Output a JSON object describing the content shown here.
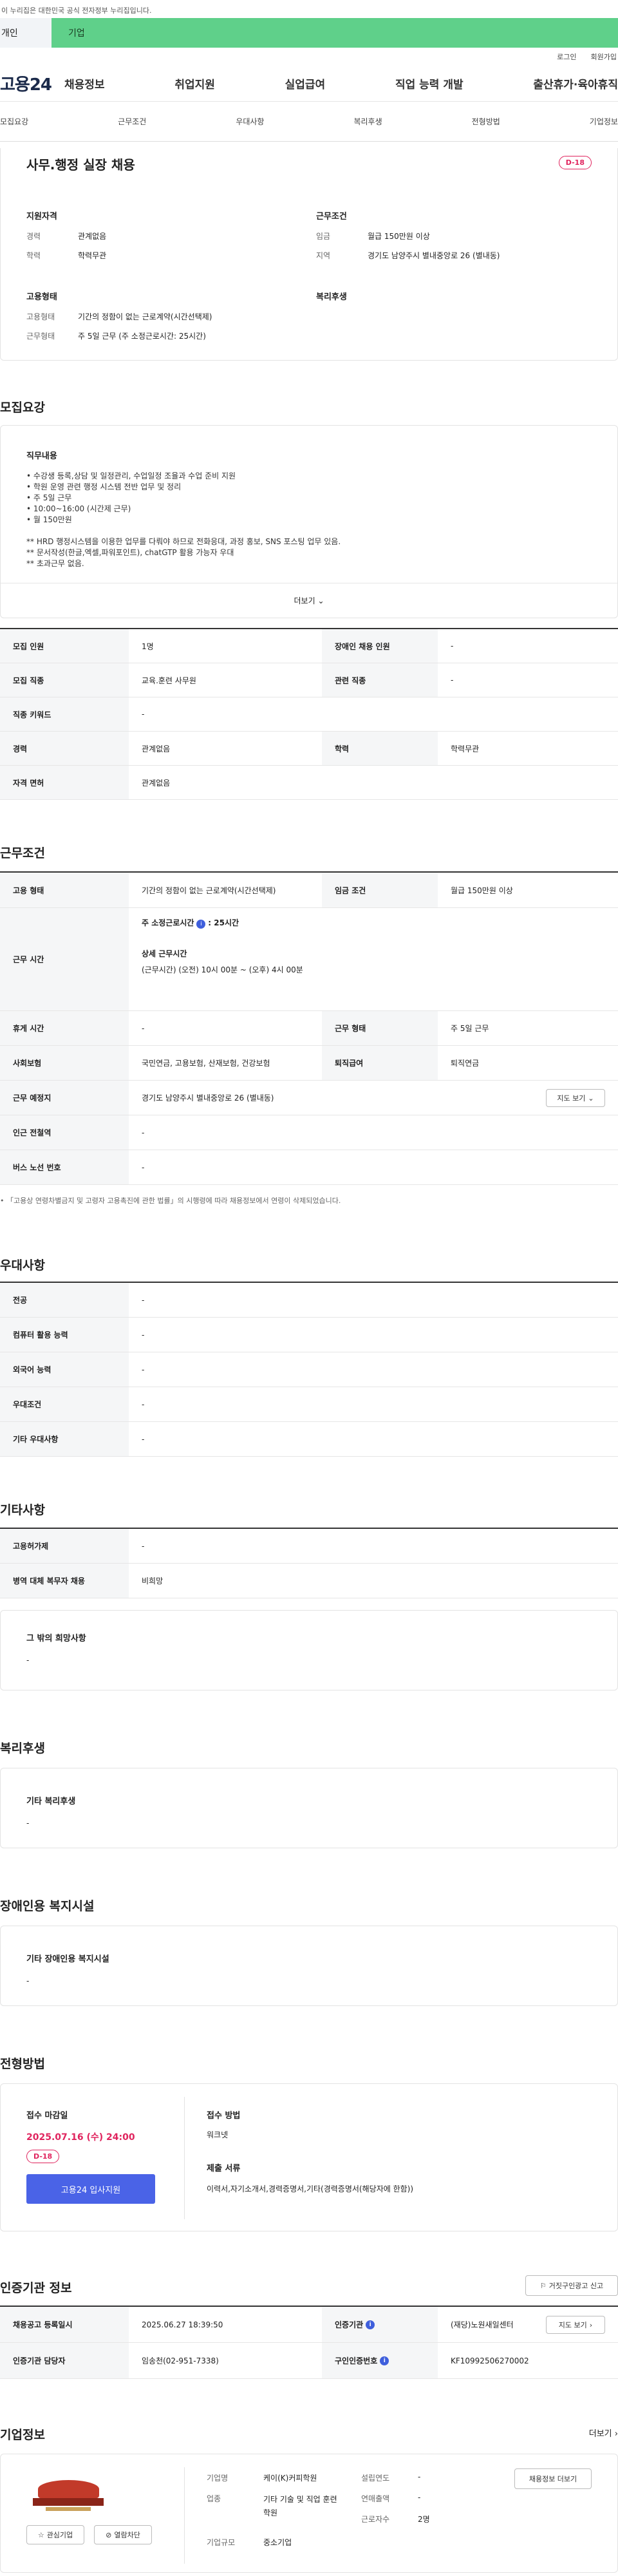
{
  "gov_banner": "이 누리집은 대한민국 공식 전자정부 누리집입니다.",
  "tabs": [
    "개인",
    "기업"
  ],
  "util": [
    "로그인",
    "회원가입"
  ],
  "logo": "고용24",
  "gnb": [
    "채용정보",
    "취업지원",
    "실업급여",
    "직업 능력 개발",
    "출산휴가·육아휴직"
  ],
  "snb": [
    "모집요강",
    "근무조건",
    "우대사항",
    "복리후생",
    "전형방법",
    "기업정보"
  ],
  "title": "사무.행정 실장 채용",
  "dday": "D-18",
  "summary": {
    "qual_title": "지원자격",
    "qual": [
      [
        "경력",
        "관계없음"
      ],
      [
        "학력",
        "학력무관"
      ]
    ],
    "cond_title": "근무조건",
    "cond": [
      [
        "임금",
        "월급 150만원 이상"
      ],
      [
        "지역",
        "경기도 남양주시 별내중앙로 26 (별내동)"
      ]
    ],
    "emp_title": "고용형태",
    "emp": [
      [
        "고용형태",
        "기간의 정함이 없는 근로계약(시간선택제)"
      ],
      [
        "근무형태",
        "주 5일 근무 (주 소정근로시간: 25시간)"
      ]
    ],
    "welfare_title": "복리후생"
  },
  "recruit": {
    "title": "모집요강",
    "job_title": "직무내용",
    "lines": [
      "• 수강생 등록,상담 및 일정관리, 수업일정 조율과 수업 준비 지원",
      "• 학원 운영 관련 행정 시스템 전반 업무 및 정리",
      "• 주 5일 근무",
      "• 10:00~16:00 (시간제 근무)",
      "• 월 150만원",
      "",
      "** HRD 행정시스템을 이용한 업무를 다뤄야 하므로 전화응대, 과정 홍보, SNS 포스팅 업무 있음.",
      "** 문서작성(한글,엑셀,파워포인트), chatGTP 활용 가능자 우대",
      "** 초과근무 없음."
    ],
    "more": "더보기",
    "rows": [
      [
        "모집 인원",
        "1명",
        "장애인 채용 인원",
        "-"
      ],
      [
        "모집 직종",
        "교육.훈련 사무원",
        "관련 직종",
        "-"
      ],
      [
        "직종 키워드",
        "-"
      ],
      [
        "경력",
        "관계없음",
        "학력",
        "학력무관"
      ],
      [
        "자격 면허",
        "관계없음"
      ]
    ]
  },
  "work": {
    "title": "근무조건",
    "emp_h": "고용 형태",
    "emp_v": "기간의 정함이 없는 근로계약(시간선택제)",
    "wage_h": "임금 조건",
    "wage_v": "월급 150만원 이상",
    "time_h": "근무 시간",
    "weekly": "주 소정근로시간",
    "weekly_v": ": 25시간",
    "detail_h": "상세 근무시간",
    "detail_v": "(근무시간) (오전) 10시 00분 ~ (오후) 4시 00분",
    "rest_h": "휴게 시간",
    "rest_v": "-",
    "form_h": "근무 형태",
    "form_v": "주 5일 근무",
    "ins_h": "사회보험",
    "ins_v": "국민연금, 고용보험, 산재보험, 건강보험",
    "ret_h": "퇴직급여",
    "ret_v": "퇴직연금",
    "place_h": "근무 예정지",
    "place_v": "경기도 남양주시 별내중앙로 26 (별내동)",
    "map_btn": "지도 보기",
    "sub_h": "인근 전철역",
    "sub_v": "-",
    "bus_h": "버스 노선 번호",
    "bus_v": "-",
    "note": "• 「고용상 연령차별금지 및 고령자 고용촉진에 관한 법률」의 시행령에 따라 채용정보에서 연령이 삭제되었습니다."
  },
  "pref": {
    "title": "우대사항",
    "rows": [
      [
        "전공",
        "-"
      ],
      [
        "컴퓨터 활용 능력",
        "-"
      ],
      [
        "외국어 능력",
        "-"
      ],
      [
        "우대조건",
        "-"
      ],
      [
        "기타 우대사항",
        "-"
      ]
    ]
  },
  "etc": {
    "title": "기타사항",
    "rows": [
      [
        "고용허가제",
        "-"
      ],
      [
        "병역 대체 복무자 채용",
        "비희망"
      ]
    ],
    "box_title": "그 밖의 희망사항",
    "box_v": "-"
  },
  "welfare": {
    "title": "복리후생",
    "box_title": "기타 복리후생",
    "box_v": "-"
  },
  "disab": {
    "title": "장애인용 복지시설",
    "box_title": "기타 장애인용 복지시설",
    "box_v": "-"
  },
  "apply": {
    "title": "전형방법",
    "deadline_h": "접수 마감일",
    "deadline": "2025.07.16 (수) 24:00",
    "dday": "D-18",
    "btn": "고용24 입사지원",
    "method_h": "접수 방법",
    "method_v": "워크넷",
    "docs_h": "제출 서류",
    "docs_v": "이력서,자기소개서,경력증명서,기타(경력증명서(해당자에 한함))"
  },
  "cert": {
    "title": "인증기관 정보",
    "report_btn": "거짓구인광고 신고",
    "reg_h": "채용공고 등록일시",
    "reg_v": "2025.06.27 18:39:50",
    "agency_h": "인증기관",
    "agency_v": "(재당)노원새일센터",
    "map_btn": "지도 보기",
    "mgr_h": "인증기관 담당자",
    "mgr_v": "임송천(02-951-7338)",
    "num_h": "구인인증번호",
    "num_v": "KF10992506270002"
  },
  "company": {
    "title": "기업정보",
    "more": "더보기",
    "fav": "관심기업",
    "block": "열람차단",
    "info_btn": "채용정보 더보기",
    "name_h": "기업명",
    "name_v": "케이(K)커피학원",
    "ind_h": "업종",
    "ind_v": "기타 기술 및 직업 훈련학원",
    "size_h": "기업규모",
    "size_v": "중소기업",
    "year_h": "설립연도",
    "year_v": "-",
    "sales_h": "연매출액",
    "sales_v": "-",
    "emp_h": "근로자수",
    "emp_v": "2명"
  }
}
